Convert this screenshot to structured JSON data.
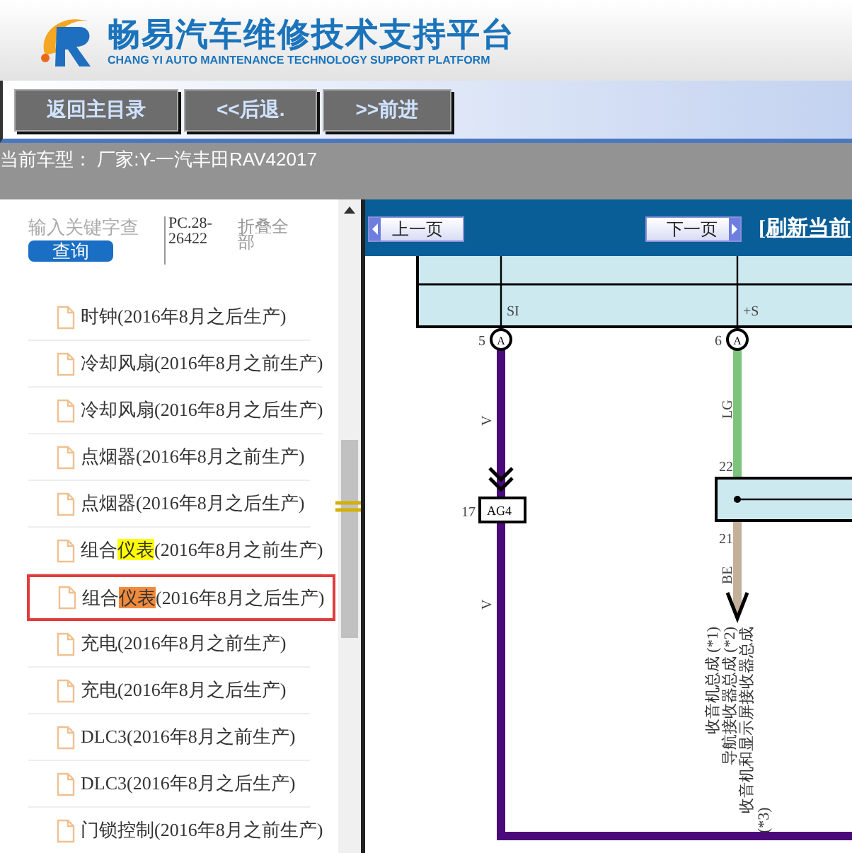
{
  "header": {
    "title": "畅易汽车维修技术支持平台",
    "subtitle": "CHANG YI AUTO MAINTENANCE TECHNOLOGY SUPPORT PLATFORM"
  },
  "toolbar": {
    "buttons": [
      "返回主目录",
      "<<后退.",
      ">>前进"
    ]
  },
  "current_model": "当前车型： 厂家:Y-一汽丰田RAV42017",
  "search": {
    "placeholder": "输入关键字查",
    "button": "查询",
    "code": "PC.28-26422",
    "collapse": "折叠全部"
  },
  "tree": [
    {
      "text": "时钟(2016年8月之后生产)",
      "selected": false
    },
    {
      "text": "冷却风扇(2016年8月之前生产)",
      "selected": false
    },
    {
      "text": "冷却风扇(2016年8月之后生产)",
      "selected": false
    },
    {
      "text": "点烟器(2016年8月之前生产)",
      "selected": false
    },
    {
      "text": "点烟器(2016年8月之后生产)",
      "selected": false
    },
    {
      "text": "组合",
      "match": "仪表",
      "color": "#ffff00",
      "text_after": "(2016年8月之前生产)",
      "selected": false
    },
    {
      "text": "组合",
      "match": "仪表",
      "color": "#f08a3c",
      "text_after": "(2016年8月之后生产)",
      "selected": true
    },
    {
      "text": "充电(2016年8月之前生产)",
      "selected": false
    },
    {
      "text": "充电(2016年8月之后生产)",
      "selected": false
    },
    {
      "text": "DLC3(2016年8月之前生产)",
      "selected": false
    },
    {
      "text": "DLC3(2016年8月之后生产)",
      "selected": false
    },
    {
      "text": "门锁控制(2016年8月之前生产)",
      "selected": false
    }
  ],
  "viewer": {
    "prev": "上一页",
    "next": "下一页",
    "refresh": "[刷新当前",
    "diagram": {
      "pin_left": "SI",
      "pin_right": "+S",
      "pin_left_no": "5",
      "pin_right_no": "6",
      "connector_left": "A",
      "connector_right": "A",
      "wire_left": "V",
      "wire_left_lower": "V",
      "wire_right": "LG",
      "pin_22": "22",
      "pin_17": "17",
      "junction": "AG4",
      "pin_21": "21",
      "wire_right_lower": "BE",
      "labels": [
        "收音机总成 (*1)",
        "导航接收器总成 (*2)",
        "收音机和显示屏接收器总成",
        "(*3)"
      ]
    }
  }
}
